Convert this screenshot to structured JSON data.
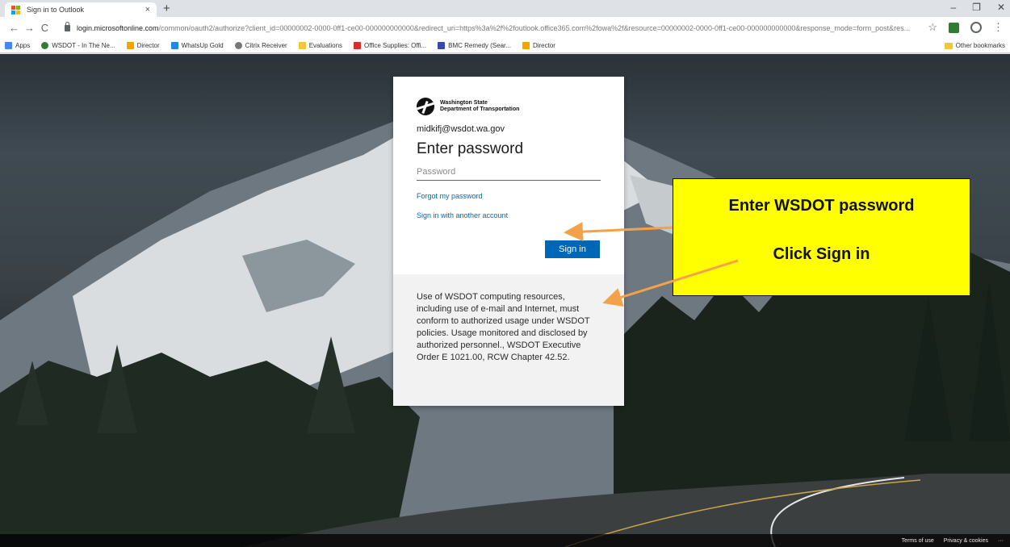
{
  "browser": {
    "tab_title": "Sign in to Outlook",
    "tab_close": "×",
    "new_tab": "+",
    "window_controls": [
      "–",
      "❐",
      "✕"
    ],
    "url_host": "login.microsoftonline.com",
    "url_path": "/common/oauth2/authorize?client_id=00000002-0000-0ff1-ce00-000000000000&redirect_uri=https%3a%2f%2foutlook.office365.com%2fowa%2f&resource=00000002-0000-0ff1-ce00-000000000000&response_mode=form_post&res...",
    "nav": {
      "back": "←",
      "forward": "→",
      "reload": "C"
    },
    "star": "☆",
    "menu": "⋮",
    "bookmarks": [
      {
        "label": "Apps",
        "icon": "apps-grid-icon",
        "color": "#4285f4"
      },
      {
        "label": "WSDOT - In The Ne...",
        "icon": "globe-icon",
        "color": "#2e7d32"
      },
      {
        "label": "Director",
        "icon": "directory-icon",
        "color": "#f4a300"
      },
      {
        "label": "WhatsUp Gold",
        "icon": "whatsup-icon",
        "color": "#1e88e5"
      },
      {
        "label": "Citrix Receiver",
        "icon": "citrix-icon",
        "color": "#777777"
      },
      {
        "label": "Evaluations",
        "icon": "folder-icon",
        "color": "#f4c542"
      },
      {
        "label": "Office Supplies: Offi...",
        "icon": "office-depot-icon",
        "color": "#d32f2f"
      },
      {
        "label": "BMC Remedy (Sear...",
        "icon": "bmc-icon",
        "color": "#3949ab"
      },
      {
        "label": "Director",
        "icon": "directory-icon",
        "color": "#f4a300"
      }
    ],
    "other_bookmarks": "Other bookmarks"
  },
  "signin": {
    "org_line1": "Washington State",
    "org_line2": "Department of Transportation",
    "email": "midkifj@wsdot.wa.gov",
    "heading": "Enter password",
    "password_placeholder": "Password",
    "password_value": "",
    "forgot_link": "Forgot my password",
    "another_account_link": "Sign in with another account",
    "signin_button": "Sign in",
    "notice": "Use of WSDOT computing resources, including use of e-mail and Internet, must conform to authorized usage under WSDOT policies. Usage monitored and disclosed by authorized personnel., WSDOT Executive Order E 1021.00, RCW Chapter 42.52."
  },
  "footer": {
    "terms": "Terms of use",
    "privacy": "Privacy & cookies",
    "more": "···"
  },
  "annotation": {
    "line1": "Enter WSDOT password",
    "line2": "Click Sign in",
    "background": "#ffff00",
    "arrow_color": "#f4a24a"
  },
  "colors": {
    "accent": "#0067b8",
    "card": "#ffffff",
    "card_footer": "#f2f2f2"
  }
}
